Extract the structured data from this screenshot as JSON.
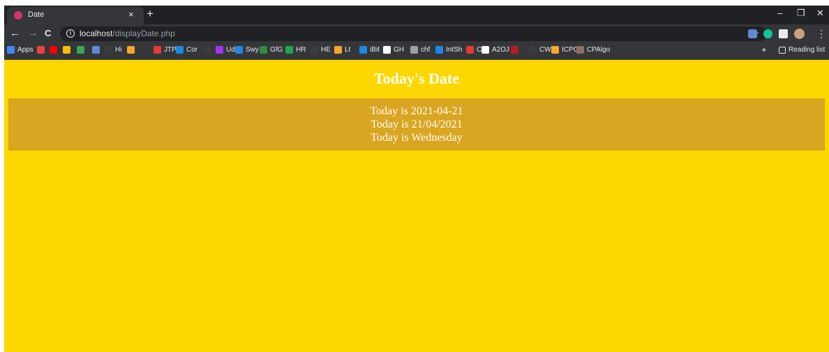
{
  "tab": {
    "title": "Date",
    "close": "×",
    "new_tab": "+"
  },
  "window_controls": {
    "minimize": "–",
    "restore": "❐",
    "close": "✕"
  },
  "nav": {
    "back": "←",
    "forward": "→",
    "reload": "C"
  },
  "address": {
    "info": "i",
    "host": "localhost",
    "path": "/displayDate.php"
  },
  "toolbar": {
    "star": "☆",
    "menu": "⋮"
  },
  "bookmarks": [
    {
      "label": "Apps",
      "color": "#4285f4"
    },
    {
      "label": "",
      "color": "#ea4335"
    },
    {
      "label": "",
      "color": "#ff0000"
    },
    {
      "label": "",
      "color": "#fbbc05"
    },
    {
      "label": "",
      "color": "#34a853"
    },
    {
      "label": "",
      "color": "#5c8ad9"
    },
    {
      "label": "Hi",
      "color": "#3c3c3c"
    },
    {
      "label": "",
      "color": "#f5a623"
    },
    {
      "label": "JTP",
      "color": "#e53935"
    },
    {
      "label": "Cor",
      "color": "#1e88e5"
    },
    {
      "label": "",
      "color": "#3c3c3c"
    },
    {
      "label": "Ud",
      "color": "#a435f0"
    },
    {
      "label": "Swy",
      "color": "#1e88e5"
    },
    {
      "label": "GfG",
      "color": "#2f8d46"
    },
    {
      "label": "HR",
      "color": "#1ba94c"
    },
    {
      "label": "HE",
      "color": "#3c3c3c"
    },
    {
      "label": "Lt",
      "color": "#f9a825"
    },
    {
      "label": "iBit",
      "color": "#1e88e5"
    },
    {
      "label": "GH",
      "color": "#ffffff"
    },
    {
      "label": "chf",
      "color": "#a0a0a0"
    },
    {
      "label": "IntSh",
      "color": "#1e88e5"
    },
    {
      "label": "CF",
      "color": "#e53935"
    },
    {
      "label": "A2OJ",
      "color": "#ffffff"
    },
    {
      "label": "",
      "color": "#b71c1c"
    },
    {
      "label": "CW",
      "color": "#3c3c3c"
    },
    {
      "label": "ICPC",
      "color": "#f9a825"
    },
    {
      "label": "CPAlgo",
      "color": "#8d6e63"
    }
  ],
  "bookmarks_more": "»",
  "reading_list": "Reading list",
  "page": {
    "heading": "Today's Date",
    "lines": [
      "Today is 2021-04-21",
      "Today is 21/04/2021",
      "Today is Wednesday"
    ]
  },
  "colors": {
    "page_bg": "#ffd700",
    "band_bg": "#daa520",
    "text": "#ffffff"
  }
}
